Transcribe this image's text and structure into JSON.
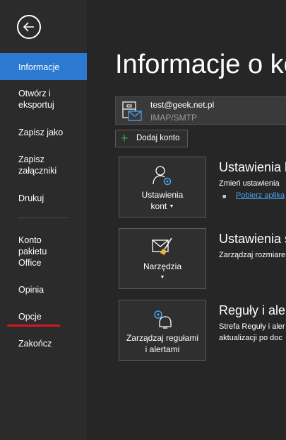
{
  "sidebar": {
    "items": [
      {
        "label": "Informacje",
        "active": true
      },
      {
        "label": "Otwórz i eksportuj"
      },
      {
        "label": "Zapisz jako"
      },
      {
        "label": "Zapisz załączniki"
      },
      {
        "label": "Drukuj"
      },
      {
        "label": "Konto pakietu Office"
      },
      {
        "label": "Opinia"
      },
      {
        "label": "Opcje"
      },
      {
        "label": "Zakończ"
      }
    ]
  },
  "main": {
    "title": "Informacje o ko",
    "account": {
      "email": "test@geek.net.pl",
      "type": "IMAP/SMTP"
    },
    "add_account_label": "Dodaj konto",
    "sections": [
      {
        "tile_label_line1": "Ustawienia",
        "tile_label_line2": "kont",
        "title": "Ustawienia k",
        "desc": "Zmień ustawienia",
        "link": "Pobierz aplika"
      },
      {
        "tile_label_line1": "Narzędzia",
        "title": "Ustawienia s",
        "desc": "Zarządzaj rozmiare"
      },
      {
        "tile_label_line1": "Zarządzaj regułami",
        "tile_label_line2": "i alertami",
        "title": "Reguły i aler",
        "desc_line1": "Strefa Reguły i aler",
        "desc_line2": "aktualizacji po doc"
      }
    ]
  },
  "colors": {
    "accent": "#2b79d0",
    "highlight": "#d9161f",
    "link": "#4aa3f0"
  }
}
